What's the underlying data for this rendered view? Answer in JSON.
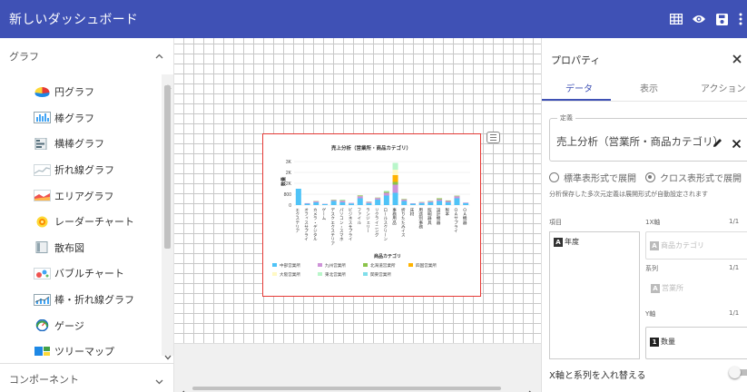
{
  "header": {
    "title": "新しいダッシュボード",
    "icons": [
      "grid-icon",
      "eye-icon",
      "save-icon",
      "more-vert-icon"
    ]
  },
  "left_panel": {
    "graph_section_label": "グラフ",
    "component_section_label": "コンポーネント",
    "chart_types": [
      {
        "label": "円グラフ",
        "icon": "pie-chart-icon"
      },
      {
        "label": "棒グラフ",
        "icon": "bar-chart-icon"
      },
      {
        "label": "横棒グラフ",
        "icon": "horizontal-bar-chart-icon"
      },
      {
        "label": "折れ線グラフ",
        "icon": "line-chart-icon"
      },
      {
        "label": "エリアグラフ",
        "icon": "area-chart-icon"
      },
      {
        "label": "レーダーチャート",
        "icon": "radar-chart-icon"
      },
      {
        "label": "散布図",
        "icon": "scatter-chart-icon"
      },
      {
        "label": "バブルチャート",
        "icon": "bubble-chart-icon"
      },
      {
        "label": "棒・折れ線グラフ",
        "icon": "bar-line-chart-icon"
      },
      {
        "label": "ゲージ",
        "icon": "gauge-icon"
      },
      {
        "label": "ツリーマップ",
        "icon": "treemap-icon"
      }
    ]
  },
  "chart_data": {
    "type": "bar",
    "stacked": true,
    "title": "売上分析（営業所・商品カテゴリ）",
    "ylabel": "数量",
    "xlabel": "商品カテゴリ",
    "yticks": [
      "3K",
      "2K",
      "2K",
      "800",
      "0"
    ],
    "ylim": [
      0,
      3200
    ],
    "categories": [
      "エクステリア",
      "オフィスサプライ",
      "カメラ・デジタル",
      "ゲーム",
      "デスクエクステリア",
      "パソコン・スマホ",
      "ビジネスサプライ",
      "ファイル",
      "ランジェリー",
      "リクライニング",
      "ロールスクリーン",
      "事務用品",
      "折りたたみイス",
      "床材",
      "用途別事務",
      "照明器具",
      "設計機器",
      "製本",
      "ＯＡサプライ",
      "ＯＡ機器"
    ],
    "legend_position": "bottom",
    "series": [
      {
        "name": "中部営業所",
        "color": "#4fc3f7",
        "values": [
          1200,
          100,
          200,
          80,
          300,
          200,
          120,
          500,
          150,
          400,
          700,
          900,
          300,
          100,
          150,
          200,
          300,
          200,
          500,
          150
        ]
      },
      {
        "name": "九州営業所",
        "color": "#ce93d8",
        "values": [
          0,
          40,
          80,
          20,
          60,
          120,
          40,
          150,
          80,
          120,
          200,
          600,
          100,
          30,
          60,
          80,
          120,
          100,
          150,
          40
        ]
      },
      {
        "name": "北海道営業所",
        "color": "#8bc34a",
        "values": [
          0,
          0,
          20,
          0,
          30,
          40,
          0,
          60,
          20,
          30,
          80,
          200,
          40,
          0,
          20,
          30,
          80,
          40,
          40,
          0
        ]
      },
      {
        "name": "四国営業所",
        "color": "#ffb300",
        "values": [
          0,
          0,
          0,
          0,
          0,
          0,
          0,
          0,
          0,
          0,
          0,
          500,
          0,
          0,
          0,
          0,
          0,
          0,
          0,
          0
        ]
      },
      {
        "name": "大阪営業所",
        "color": "#fff9c4",
        "values": [
          0,
          0,
          0,
          0,
          0,
          0,
          0,
          0,
          0,
          0,
          0,
          400,
          0,
          0,
          0,
          0,
          0,
          0,
          0,
          0
        ]
      },
      {
        "name": "東北営業所",
        "color": "#b9f6ca",
        "values": [
          0,
          0,
          0,
          0,
          0,
          40,
          0,
          0,
          0,
          0,
          80,
          500,
          0,
          0,
          0,
          0,
          0,
          0,
          0,
          0
        ]
      },
      {
        "name": "関東営業所",
        "color": "#80deea",
        "values": [
          0,
          0,
          0,
          0,
          0,
          0,
          0,
          0,
          0,
          0,
          0,
          0,
          0,
          0,
          0,
          0,
          0,
          0,
          0,
          0
        ]
      }
    ]
  },
  "right_panel": {
    "title": "プロパティ",
    "tabs": [
      "データ",
      "表示",
      "アクション"
    ],
    "definition_legend": "定義",
    "definition_value": "売上分析（営業所・商品カテゴリ）",
    "radio_standard": "標準表形式で展開",
    "radio_cross": "クロス表形式で展開",
    "note": "分析保存した多次元定義は展開形式が自動設定されます",
    "col_item": "項目",
    "col_x": "1X軸",
    "col_page": "1/1",
    "series_label": "系列",
    "y_label": "Y軸",
    "item_field": "年度",
    "x_field": "商品カテゴリ",
    "series_field": "営業所",
    "y_field": "数量",
    "swap_label": "X軸と系列を入れ替える",
    "active_color": "#3f51b5"
  }
}
